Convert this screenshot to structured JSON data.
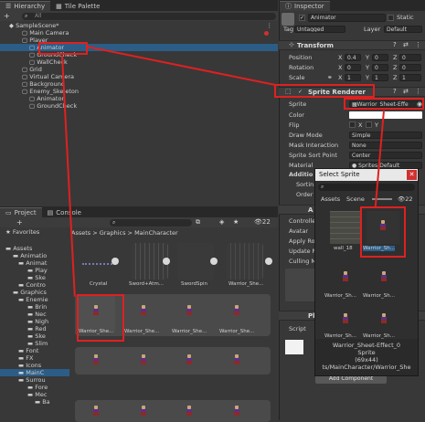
{
  "hierarchy": {
    "tabs": [
      "Hierarchy",
      "Tile Palette"
    ],
    "search_all": "All",
    "add_button": "+",
    "scene": "SampleScene*",
    "items": [
      "Main Camera",
      "Player",
      "Animator",
      "GroundCheck",
      "WallCheck",
      "Grid",
      "Virtual Camera",
      "Background",
      "Enemy_Skeleton",
      "Animator",
      "GroundCheck"
    ]
  },
  "project": {
    "tabs": [
      "Project",
      "Console"
    ],
    "add_button": "+",
    "hidden_count": "22",
    "breadcrumb": [
      "Assets",
      "Graphics",
      "MainCharacter"
    ],
    "favorites": "Favorites",
    "tree": [
      "Assets",
      "Animatio",
      "Animat",
      "Play",
      "Ske",
      "Contro",
      "Graphics",
      "Enemie",
      "Brin",
      "Nec",
      "Nigh",
      "Red",
      "Ske",
      "Slim",
      "Font",
      "FX",
      "Icons",
      "MainC",
      "Surrou",
      "Fore",
      "Mec",
      "Ba"
    ],
    "assets_row1": [
      "Crystal",
      "Sword+Atm...",
      "SwordSpin",
      "Warrior_She..."
    ],
    "selected_asset": "Warrior_She...",
    "grid_label": "Warrior_She..."
  },
  "inspector": {
    "tab": "Inspector",
    "object_name": "Animator",
    "static_label": "Static",
    "tag_label": "Tag",
    "tag_value": "Untagged",
    "layer_label": "Layer",
    "layer_value": "Default",
    "transform": {
      "title": "Transform",
      "position": [
        "0.4",
        "0",
        "0"
      ],
      "rotation": [
        "0",
        "0",
        "0"
      ],
      "scale": [
        "1",
        "1",
        "1"
      ],
      "labels": [
        "Position",
        "Rotation",
        "Scale"
      ]
    },
    "sprite_renderer": {
      "title": "Sprite Renderer",
      "sprite_label": "Sprite",
      "sprite_value": "Warrior_Sheet-Effe",
      "color_label": "Color",
      "flip_label": "Flip",
      "draw_mode_label": "Draw Mode",
      "draw_mode_value": "Simple",
      "mask_label": "Mask Interaction",
      "mask_value": "None",
      "sort_point_label": "Sprite Sort Point",
      "sort_point_value": "Center",
      "material_label": "Material",
      "material_value": "Sprites-Default",
      "additional_label": "Additio",
      "sorting_label": "Sortin",
      "order_label": "Order i"
    },
    "animator_labels": [
      "Controlle",
      "Avatar",
      "Apply Ro",
      "Update M",
      "Culling M"
    ],
    "script_label": "Script",
    "add_component": "Add Component"
  },
  "select_sprite": {
    "title": "Select Sprite",
    "tabs": [
      "Assets",
      "Scene"
    ],
    "count": "22",
    "items": [
      "wall_18",
      "Warrior_Sh...",
      "Warrior_Sh...",
      "Warrior_Sh...",
      "Warrior_Sh...",
      "Warrior_Sh..."
    ],
    "preview_name": "Warrior_Sheet-Effect_0",
    "preview_type": "Sprite",
    "preview_size": "(69x44)",
    "preview_path": "ts/MainCharacter/Warrior_She"
  },
  "colors": {
    "highlight": "#e02020",
    "selection": "#2c5d87"
  }
}
